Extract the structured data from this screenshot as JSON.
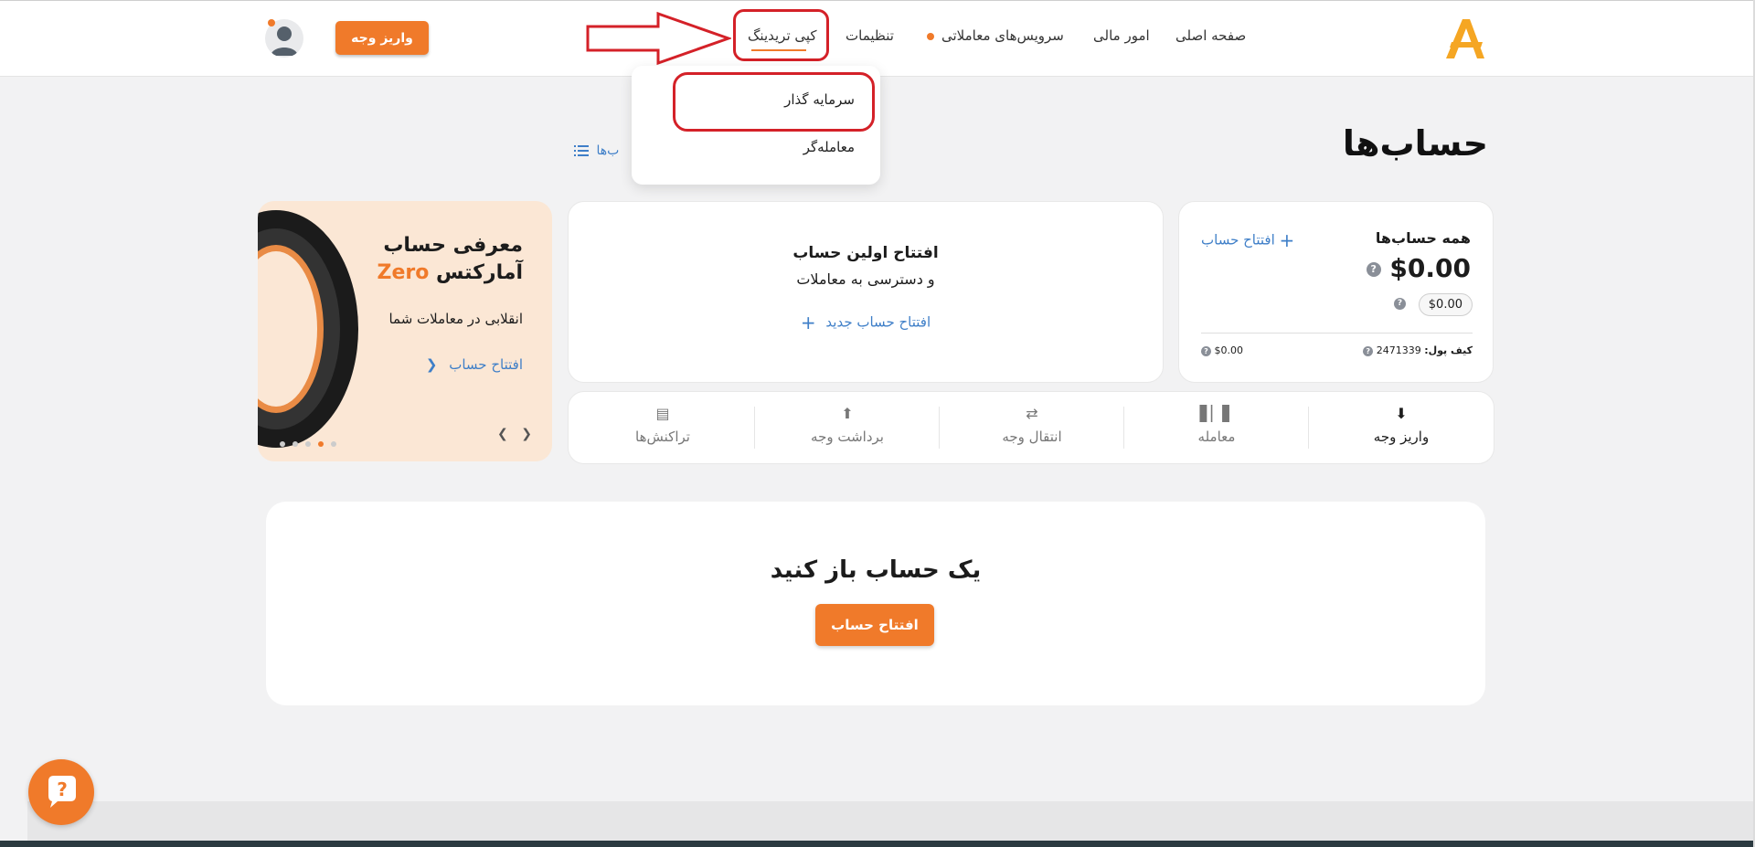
{
  "nav": {
    "home": "صفحه اصلی",
    "finance": "امور مالی",
    "trading_services": "سرویس‌های معاملاتی",
    "settings": "تنظیمات",
    "copy_trading": "کپی تریدینگ",
    "deposit_button": "واریز وجه"
  },
  "dropdown": {
    "investor": "سرمایه گذار",
    "trader": "معامله‌گر"
  },
  "page": {
    "title": "حساب‌ها",
    "list_link": "ب‌ها"
  },
  "summary": {
    "title": "همه حساب‌ها",
    "open_account": "افتتاح حساب",
    "balance": "$0.00",
    "sub_balance": "$0.00",
    "wallet_label": "کیف پول:",
    "wallet_id": "2471339",
    "wallet_balance": "$0.00"
  },
  "first_account": {
    "title": "افتتاح اولین حساب",
    "subtitle": "و دسترسی به معاملات",
    "link": "افتتاح حساب جدید"
  },
  "promo": {
    "title_line1": "معرفی حساب",
    "title_line2_prefix": "آمارکتس",
    "title_line2_highlight": "Zero",
    "description": "انقلابی در معاملات شما",
    "link": "افتتاح حساب",
    "slide_count": 5,
    "active_slide": 2
  },
  "actions": {
    "deposit": "واریز وجه",
    "trade": "معامله",
    "transfer": "انتقال وجه",
    "withdraw": "برداشت وجه",
    "transactions": "تراکنش‌ها"
  },
  "cta": {
    "title": "یک حساب باز کنید",
    "button": "افتتاح حساب"
  },
  "colors": {
    "accent": "#f07a2a",
    "link": "#3f7fc8",
    "annotation": "#d42128"
  },
  "icons": {
    "logo": "amarkets-logo",
    "help": "question-chat-icon",
    "avatar": "user-avatar-icon"
  }
}
